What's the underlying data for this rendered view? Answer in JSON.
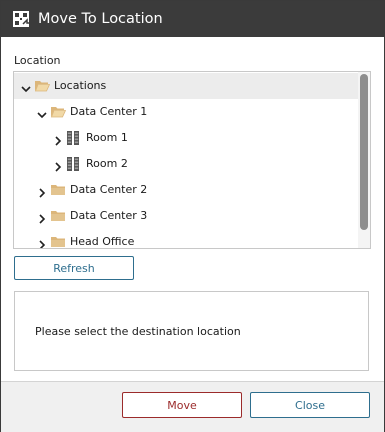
{
  "dialog": {
    "title": "Move To Location",
    "title_icon": "move-location-icon"
  },
  "location_label": "Location",
  "tree": {
    "items": [
      {
        "label": "Locations",
        "level": 0,
        "expanded": true,
        "icon": "folder-open-icon",
        "selected": true
      },
      {
        "label": "Data Center 1",
        "level": 1,
        "expanded": true,
        "icon": "folder-open-icon"
      },
      {
        "label": "Room 1",
        "level": 2,
        "expanded": false,
        "icon": "server-rack-icon"
      },
      {
        "label": "Room 2",
        "level": 2,
        "expanded": false,
        "icon": "server-rack-icon"
      },
      {
        "label": "Data Center 2",
        "level": 1,
        "expanded": false,
        "icon": "folder-icon"
      },
      {
        "label": "Data Center 3",
        "level": 1,
        "expanded": false,
        "icon": "folder-icon"
      },
      {
        "label": "Head Office",
        "level": 1,
        "expanded": false,
        "icon": "folder-icon"
      }
    ]
  },
  "refresh_label": "Refresh",
  "message": "Please select the destination location",
  "footer": {
    "move_label": "Move",
    "close_label": "Close"
  },
  "colors": {
    "titlebar": "#3b3b3b",
    "move_accent": "#9b2b2b",
    "close_accent": "#2e6e8e",
    "folder": "#dcb67a"
  }
}
